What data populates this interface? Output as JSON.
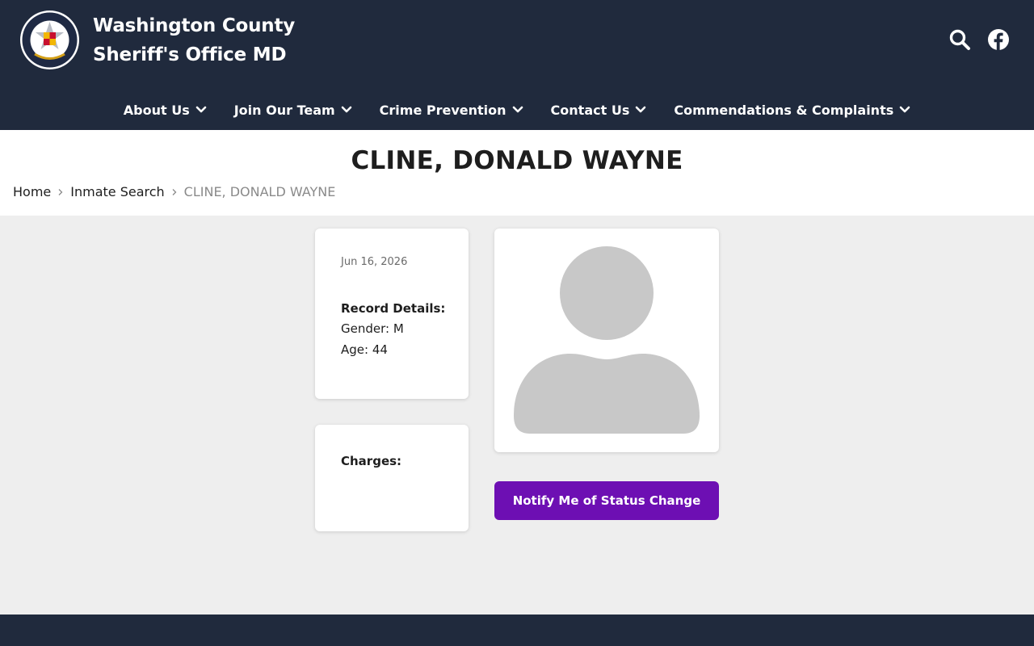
{
  "header": {
    "title_line1": "Washington County",
    "title_line2": "Sheriff's Office MD",
    "search_icon": "search-icon",
    "facebook_icon": "facebook-icon"
  },
  "nav": {
    "items": [
      {
        "label": "About Us"
      },
      {
        "label": "Join Our Team"
      },
      {
        "label": "Crime Prevention"
      },
      {
        "label": "Contact Us"
      },
      {
        "label": "Commendations & Complaints"
      }
    ]
  },
  "page": {
    "title": "CLINE, DONALD WAYNE"
  },
  "breadcrumb": {
    "home": "Home",
    "section": "Inmate Search",
    "current": "CLINE, DONALD WAYNE"
  },
  "record": {
    "date": "Jun 16, 2026",
    "heading": "Record Details:",
    "gender": "Gender: M",
    "age": "Age: 44"
  },
  "charges": {
    "heading": "Charges:"
  },
  "notify": {
    "label": "Notify Me of Status Change"
  },
  "colors": {
    "header_bg": "#202a3d",
    "button_bg": "#6d0fb3",
    "page_bg": "#eeeeee",
    "avatar": "#c8c8c8"
  }
}
